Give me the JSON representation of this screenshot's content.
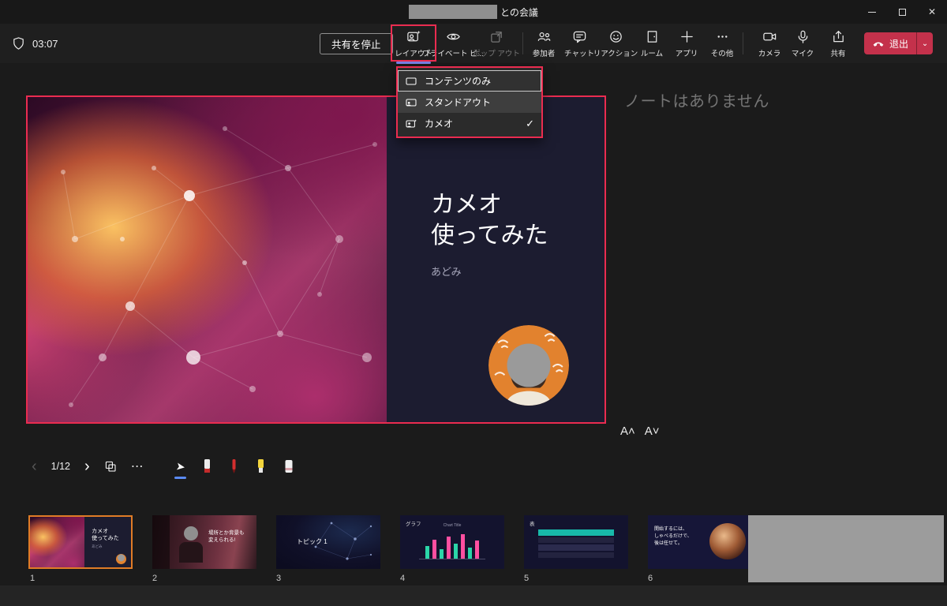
{
  "titlebar": {
    "meeting_suffix": "との会議"
  },
  "meeting": {
    "timer": "03:07"
  },
  "toolbar": {
    "stop_share": "共有を停止",
    "layout": "レイアウト",
    "private_view": "プライベート ビ...",
    "pop_out": "ポップ アウト",
    "participants": "参加者",
    "chat": "チャット",
    "reactions": "リアクション",
    "rooms": "ルーム",
    "apps": "アプリ",
    "more": "その他",
    "camera": "カメラ",
    "mic": "マイク",
    "share": "共有",
    "leave": "退出"
  },
  "layout_menu": {
    "items": [
      {
        "label": "コンテンツのみ",
        "checked": false
      },
      {
        "label": "スタンドアウト",
        "checked": false
      },
      {
        "label": "カメオ",
        "checked": true
      }
    ]
  },
  "slide": {
    "title_line1": "カメオ",
    "title_line2": "使ってみた",
    "subtitle": "あどみ"
  },
  "notes": {
    "empty_text": "ノートはありません"
  },
  "font_controls": {
    "increase": "A˄",
    "decrease": "A˅"
  },
  "slide_nav": {
    "page": "1/12"
  },
  "filmstrip": {
    "slides": [
      {
        "number": "1",
        "title_line1": "カメオ",
        "title_line2": "使ってみた",
        "subtitle": "あどみ",
        "selected": true
      },
      {
        "number": "2",
        "caption_line1": "場所とか背景も",
        "caption_line2": "変えられる!"
      },
      {
        "number": "3",
        "title": "トピック 1"
      },
      {
        "number": "4",
        "label": "グラフ",
        "chart_title": "Chart Title",
        "bars": [
          45,
          70,
          35,
          80,
          55,
          90,
          40,
          65
        ]
      },
      {
        "number": "5",
        "label": "表"
      },
      {
        "number": "6",
        "text_line1": "開始するには、",
        "text_line2": "しゃべるだけで、",
        "text_line3": "後は任せて。"
      }
    ]
  },
  "icons": {
    "close": "✕",
    "check": "✓",
    "chevron_left": "‹",
    "chevron_right": "›",
    "chevron_down": "⌄",
    "more_dots": "⋯",
    "laser": "➤"
  },
  "colors": {
    "annotation_red": "#ea2c50",
    "accent_purple": "#7b83eb",
    "leave_red": "#c4314b",
    "selected_orange": "#e07c26",
    "redaction_gray": "#9c9c9c"
  }
}
